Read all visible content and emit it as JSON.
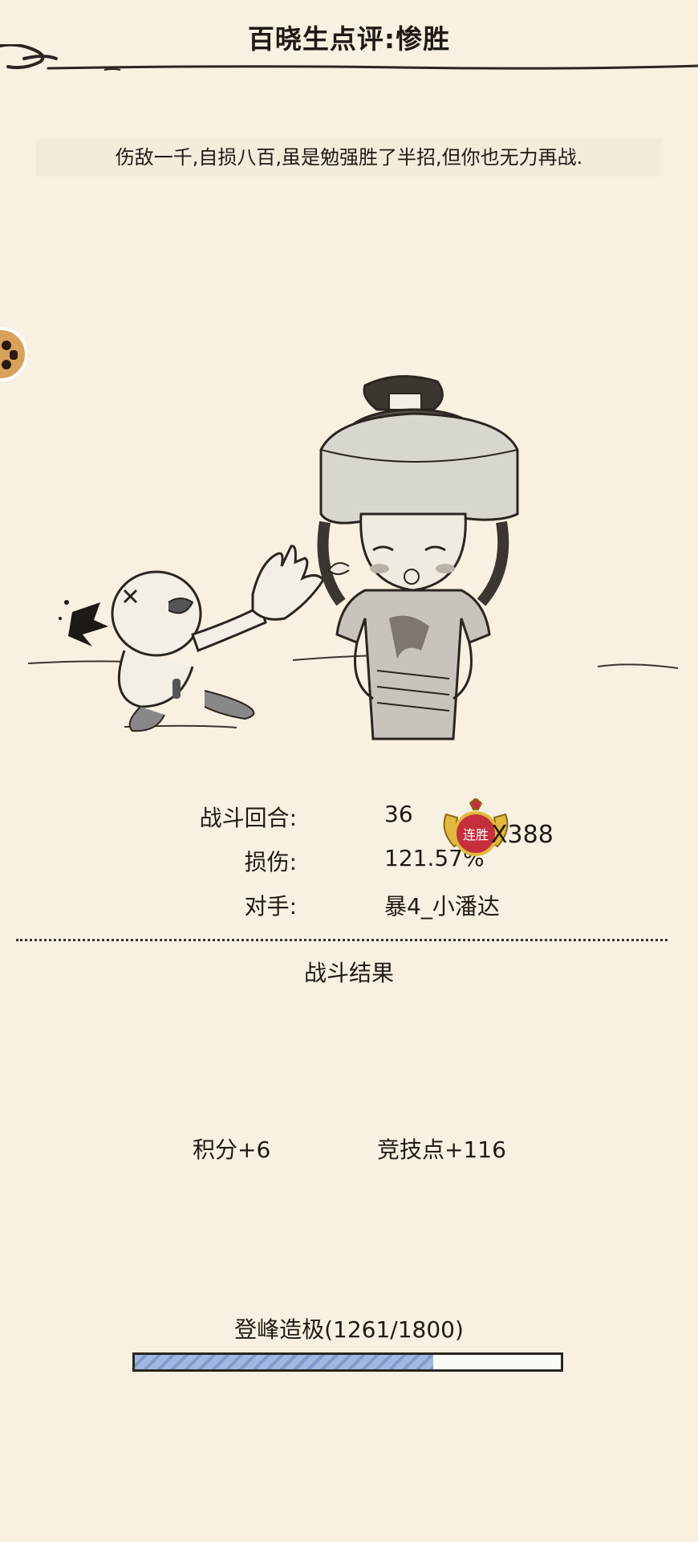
{
  "header": {
    "title": "百晓生点评:惨胜"
  },
  "description": "伤敌一千,自损八百,虽是勉强胜了半招,但你也无力再战.",
  "stats": [
    {
      "label": "战斗回合:",
      "value": "36"
    },
    {
      "label": "损伤:",
      "value": "121.57%"
    },
    {
      "label": "对手:",
      "value": "暴4_小潘达"
    }
  ],
  "streak": {
    "badge_text": "连胜",
    "count_text": "X388"
  },
  "result": {
    "title": "战斗结果",
    "points": "积分+6",
    "arena_points": "竞技点+116"
  },
  "rank": {
    "label": "登峰造极(1261/1800)",
    "current": 1261,
    "max": 1800
  },
  "colors": {
    "background": "#f8f1e1",
    "progress_fill": "#9fb9e2",
    "streak_badge": "#c52f3c"
  }
}
